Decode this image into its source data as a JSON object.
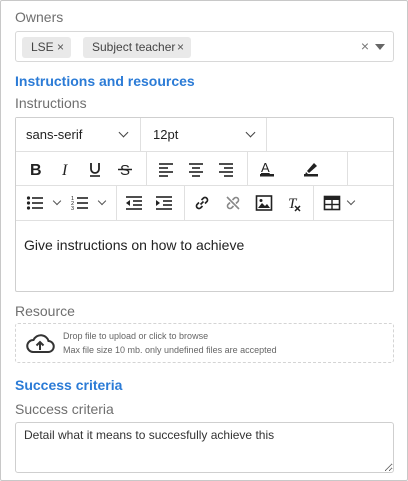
{
  "owners": {
    "label": "Owners",
    "chips": [
      {
        "text": "LSE",
        "remove": "×"
      },
      {
        "text": "Subject teacher",
        "remove": "×"
      }
    ],
    "clear": "×"
  },
  "instructions_section": {
    "title": "Instructions and resources",
    "instructions_label": "Instructions",
    "editor": {
      "font_family": "sans-serif",
      "font_size": "12pt",
      "content": "Give instructions on how to achieve",
      "icons": [
        "bold-icon",
        "italic-icon",
        "underline-icon",
        "strikethrough-icon",
        "align-left-icon",
        "align-center-icon",
        "align-right-icon",
        "text-color-icon",
        "highlight-icon",
        "bullet-list-icon",
        "numbered-list-icon",
        "outdent-icon",
        "indent-icon",
        "link-icon",
        "unlink-icon",
        "image-icon",
        "clear-format-icon",
        "table-icon"
      ]
    }
  },
  "resource": {
    "label": "Resource",
    "drop_text": "Drop file to upload or click to browse",
    "limit_text": "Max file size 10 mb. only undefined files are accepted"
  },
  "success_section": {
    "title": "Success criteria",
    "label": "Success criteria",
    "value": "Detail what it means to succesfully achieve this"
  },
  "colors": {
    "accent": "#2b7bd6",
    "label": "#6f6f6f",
    "chip_bg": "#e9e9e9"
  }
}
